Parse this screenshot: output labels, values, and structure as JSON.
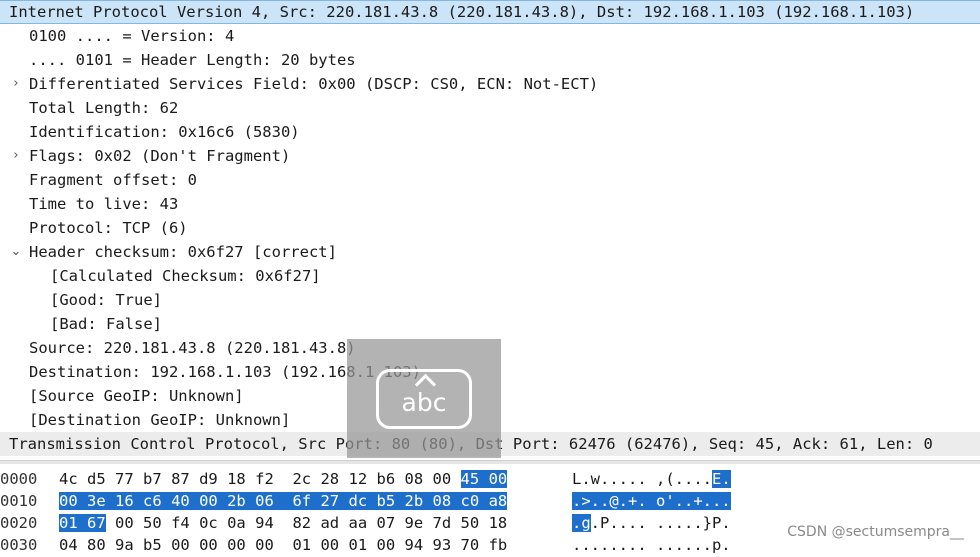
{
  "tree": [
    {
      "id": "ipv4-header",
      "indent": 0,
      "arrow": "",
      "text": "Internet Protocol Version 4, Src: 220.181.43.8 (220.181.43.8), Dst: 192.168.1.103 (192.168.1.103)",
      "state": "selected"
    },
    {
      "id": "version",
      "indent": 1,
      "arrow": "",
      "text": "0100 .... = Version: 4"
    },
    {
      "id": "header-length",
      "indent": 1,
      "arrow": "",
      "text": ".... 0101 = Header Length: 20 bytes"
    },
    {
      "id": "dsf",
      "indent": 1,
      "arrow": "›",
      "text": "Differentiated Services Field: 0x00 (DSCP: CS0, ECN: Not-ECT)"
    },
    {
      "id": "total-length",
      "indent": 1,
      "arrow": "",
      "text": "Total Length: 62"
    },
    {
      "id": "identification",
      "indent": 1,
      "arrow": "",
      "text": "Identification: 0x16c6 (5830)"
    },
    {
      "id": "flags",
      "indent": 1,
      "arrow": "›",
      "text": "Flags: 0x02 (Don't Fragment)"
    },
    {
      "id": "fragment-offset",
      "indent": 1,
      "arrow": "",
      "text": "Fragment offset: 0"
    },
    {
      "id": "ttl",
      "indent": 1,
      "arrow": "",
      "text": "Time to live: 43"
    },
    {
      "id": "protocol",
      "indent": 1,
      "arrow": "",
      "text": "Protocol: TCP (6)"
    },
    {
      "id": "header-checksum",
      "indent": 1,
      "arrow": "⌄",
      "text": "Header checksum: 0x6f27 [correct]"
    },
    {
      "id": "calc-checksum",
      "indent": 2,
      "arrow": "",
      "text": "[Calculated Checksum: 0x6f27]"
    },
    {
      "id": "good",
      "indent": 2,
      "arrow": "",
      "text": "[Good: True]"
    },
    {
      "id": "bad",
      "indent": 2,
      "arrow": "",
      "text": "[Bad: False]"
    },
    {
      "id": "source",
      "indent": 1,
      "arrow": "",
      "text": "Source: 220.181.43.8 (220.181.43.8)"
    },
    {
      "id": "destination",
      "indent": 1,
      "arrow": "",
      "text": "Destination: 192.168.1.103 (192.168.1.103)"
    },
    {
      "id": "source-geoip",
      "indent": 1,
      "arrow": "",
      "text": "[Source GeoIP: Unknown]"
    },
    {
      "id": "dest-geoip",
      "indent": 1,
      "arrow": "",
      "text": "[Destination GeoIP: Unknown]"
    },
    {
      "id": "tcp-header",
      "indent": 0,
      "arrow": "",
      "text": "Transmission Control Protocol, Src Port: 80 (80), Dst Port: 62476 (62476), Seq: 45, Ack: 61, Len: 0",
      "state": "header"
    }
  ],
  "hex_rows": [
    {
      "offset": "0000",
      "bytes": [
        "4c",
        "d5",
        "77",
        "b7",
        "87",
        "d9",
        "18",
        "f2",
        "2c",
        "28",
        "12",
        "b6",
        "08",
        "00",
        "45",
        "00"
      ],
      "ascii": "L.w..... ,(....E.",
      "hl_start": 14
    },
    {
      "offset": "0010",
      "bytes": [
        "00",
        "3e",
        "16",
        "c6",
        "40",
        "00",
        "2b",
        "06",
        "6f",
        "27",
        "dc",
        "b5",
        "2b",
        "08",
        "c0",
        "a8"
      ],
      "ascii": ".>..@.+. o'..+...",
      "hl_start": 0
    },
    {
      "offset": "0020",
      "bytes": [
        "01",
        "67",
        "00",
        "50",
        "f4",
        "0c",
        "0a",
        "94",
        "82",
        "ad",
        "aa",
        "07",
        "9e",
        "7d",
        "50",
        "18"
      ],
      "ascii": ".g.P.... .....}P.",
      "hl_start": 0,
      "hl_end": 2
    },
    {
      "offset": "0030",
      "bytes": [
        "04",
        "80",
        "9a",
        "b5",
        "00",
        "00",
        "00",
        "00",
        "01",
        "00",
        "01",
        "00",
        "94",
        "93",
        "70",
        "fb"
      ],
      "ascii": "........ ......p."
    }
  ],
  "overlay": {
    "ime_label": "abc"
  },
  "watermark": "CSDN @sectumsempra__",
  "colors": {
    "selected": "#cce4f7",
    "highlight": "#1e6fcc",
    "header_bg": "#ececec"
  }
}
